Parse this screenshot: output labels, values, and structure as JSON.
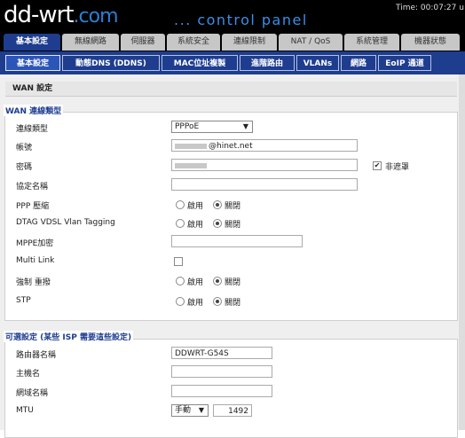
{
  "header": {
    "logo_main": "dd-wrt",
    "logo_suffix": ".com",
    "subtitle": "... control panel",
    "time_label": "Time: 00:07:27 u"
  },
  "main_tabs": [
    "基本設定",
    "無線網路",
    "伺服器",
    "系統安全",
    "連線限制",
    "NAT / QoS",
    "系統管理",
    "機器狀態"
  ],
  "sub_tabs": [
    "基本設定",
    "動態DNS (DDNS)",
    "MAC位址複製",
    "進階路由",
    "VLANs",
    "網路",
    "EoIP 通道"
  ],
  "page_title": "WAN 設定",
  "wan_section": {
    "legend": "WAN 連線類型",
    "conn_type_label": "連線類型",
    "conn_type_value": "PPPoE",
    "username_label": "帳號",
    "username_value": "@hinet.net",
    "password_label": "密碼",
    "unmask_label": "非遮罩",
    "service_label": "協定名稱",
    "ppp_comp_label": "PPP 壓縮",
    "dtag_label": "DTAG VDSL Vlan Tagging",
    "mppe_label": "MPPE加密",
    "multilink_label": "Multi Link",
    "reconnect_label": "強制 重撥",
    "stp_label": "STP",
    "enable_label": "啟用",
    "disable_label": "關閉"
  },
  "optional_section": {
    "legend": "可選設定 (某些 ISP 需要這些設定)",
    "router_name_label": "路由器名稱",
    "router_name_value": "DDWRT-G54S",
    "hostname_label": "主機名",
    "domain_label": "網域名稱",
    "mtu_label": "MTU",
    "mtu_mode": "手動",
    "mtu_value": "1492"
  }
}
